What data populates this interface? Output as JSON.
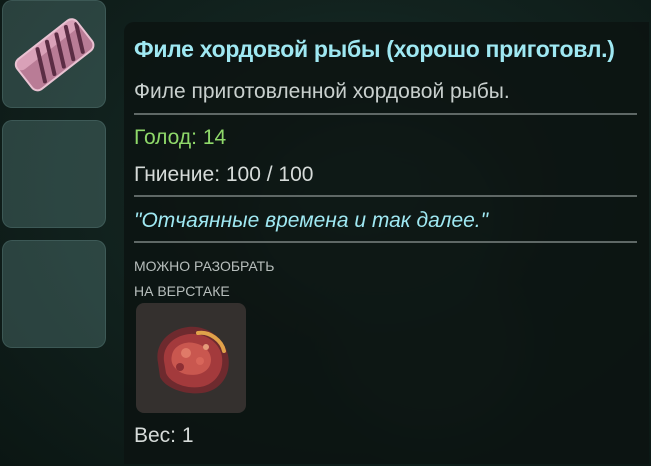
{
  "item": {
    "title": "Филе хордовой рыбы (хорошо приготовл.)",
    "description": "Филе приготовленной хордовой рыбы.",
    "hunger": "Голод: 14",
    "decay": "Гниение: 100 / 100",
    "quote": "\"Отчаянные времена и так далее.\"",
    "disassemble_line1": "МОЖНО РАЗОБРАТЬ",
    "disassemble_line2": "НА ВЕРСТАКЕ",
    "weight": "Вес: 1",
    "icon": "cooked-fish-fillet-icon",
    "material_icon": "raw-meat-chunk-icon"
  },
  "colors": {
    "title": "#9fe8f2",
    "hunger": "#8fd96a",
    "quote": "#9fe8f2"
  }
}
